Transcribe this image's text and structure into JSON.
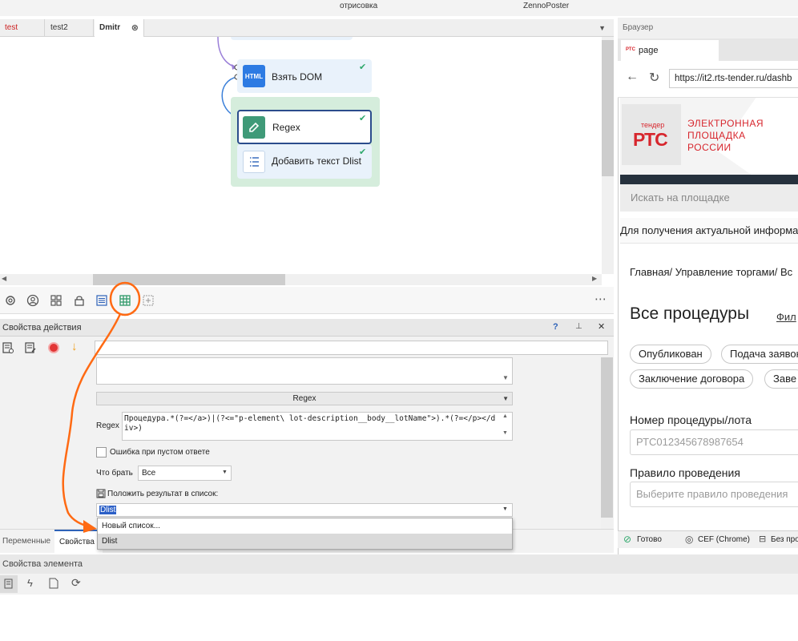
{
  "window": {
    "title_left": "отрисовка",
    "title_right": "ZennoPoster"
  },
  "editor": {
    "tabs": [
      {
        "label": "test",
        "color": "#cc2222"
      },
      {
        "label": "test2"
      },
      {
        "label": "Dmitr",
        "active": true
      }
    ],
    "nodes": [
      {
        "icon_text": "HTML",
        "label": "Взять DOM",
        "icon_color": "#2d7be3"
      },
      {
        "icon_text": "pencil",
        "label": "Regex",
        "icon_color": "#3f9a78"
      },
      {
        "icon_text": "list",
        "label": "Добавить текст Dlist",
        "icon_color": "#ffffff"
      }
    ],
    "toolbar_icons": [
      "gear-icon",
      "user-icon",
      "grid-icon",
      "lock-icon",
      "list-icon",
      "table-icon",
      "add-icon",
      "more-icon"
    ]
  },
  "properties": {
    "title": "Свойства действия",
    "help": "?",
    "pin": "✦",
    "close": "✕",
    "mode_label": "Regex",
    "regex_label": "Regex",
    "regex_value": "Процедура.*(?=</a>)|(?<=\"p-element\\ lot-description__body__lotName\">).*(?=</p></div>)",
    "empty_error_label": "Ошибка при пустом ответе",
    "what_take_label": "Что брать",
    "what_take_value": "Все",
    "put_result_label": "Положить результат в список:",
    "list_value": "Dlist",
    "dropdown_items": [
      "Новый список...",
      "Dlist"
    ]
  },
  "bottom_tabs": [
    "Переменные",
    "Свойства"
  ],
  "element_props": {
    "title": "Свойства элемента"
  },
  "browser": {
    "panel_title": "Браузер",
    "tab_logo": "РТС",
    "tab_label": "page",
    "url": "https://it2.rts-tender.ru/dashb",
    "logo_small": "тендер",
    "logo_big": "РТС",
    "brand_lines": [
      "ЭЛЕКТРОННАЯ",
      "ПЛОЩАДКА",
      "РОССИИ"
    ],
    "search_placeholder": "Искать на площадке",
    "notice": "Для получения актуальной информа",
    "breadcrumb": "Главная/ Управление торгами/ Вс",
    "heading": "Все процедуры",
    "filter_link": "Фил",
    "chips": [
      "Опубликован",
      "Подача заявок",
      "Заключение договора",
      "Заве"
    ],
    "number_label": "Номер процедуры/лота",
    "number_placeholder": "РТС012345678987654",
    "rule_label": "Правило проведения",
    "rule_placeholder": "Выберите правило проведения",
    "status_ready": "Готово",
    "status_engine": "CEF (Chrome)",
    "status_proxy": "Без про"
  },
  "colors": {
    "accent_orange": "#ff6a13",
    "rts_red": "#d7262d",
    "check_green": "#2ea86b"
  }
}
